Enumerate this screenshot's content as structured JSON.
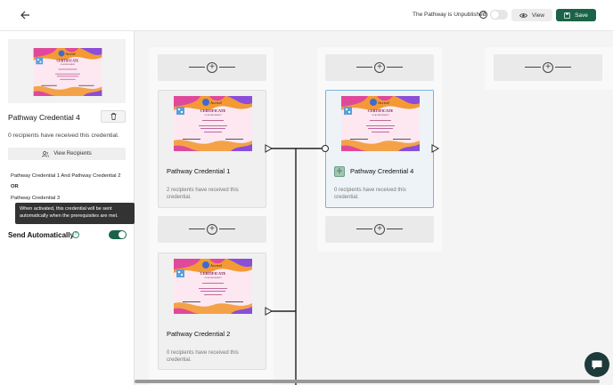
{
  "header": {
    "publish_status": "The Pathway is Unpublished",
    "help_symbol": "?",
    "view_label": "View",
    "save_label": "Save"
  },
  "left_panel": {
    "title": "Pathway Credential 4",
    "recipients_text": "0 recipients have received this credential.",
    "view_recipients_label": "View Recipients",
    "prerequisites": [
      "Pathway Credential 1 And Pathway Credential 2",
      "OR",
      "Pathway Credential 3"
    ],
    "tooltip": "When activated, this credential will be sent automatically when the prerequisites are met.",
    "send_auto_label": "Send Automatically",
    "help_symbol": "?"
  },
  "canvas": {
    "add_symbol": "+",
    "icon_symbol": "✛",
    "cards": [
      {
        "title": "Pathway Credential 1",
        "subtitle": "2 recipients have received this credential."
      },
      {
        "title": "Pathway Credential 2",
        "subtitle": "0 recipients have received this credential."
      },
      {
        "title": "Pathway Credential 4",
        "subtitle": "0 recipients have received this credential."
      }
    ]
  },
  "certificate": {
    "title": "CERTIFICATE",
    "subtitle": "OF ACHIEVEMENT",
    "brand": "Accred"
  },
  "colors": {
    "primary": "#1b6348",
    "selected_border": "#7ab2df",
    "cert_orange": "#f39a35",
    "cert_pink": "#e0499b",
    "cert_purple": "#8a4ed8"
  }
}
